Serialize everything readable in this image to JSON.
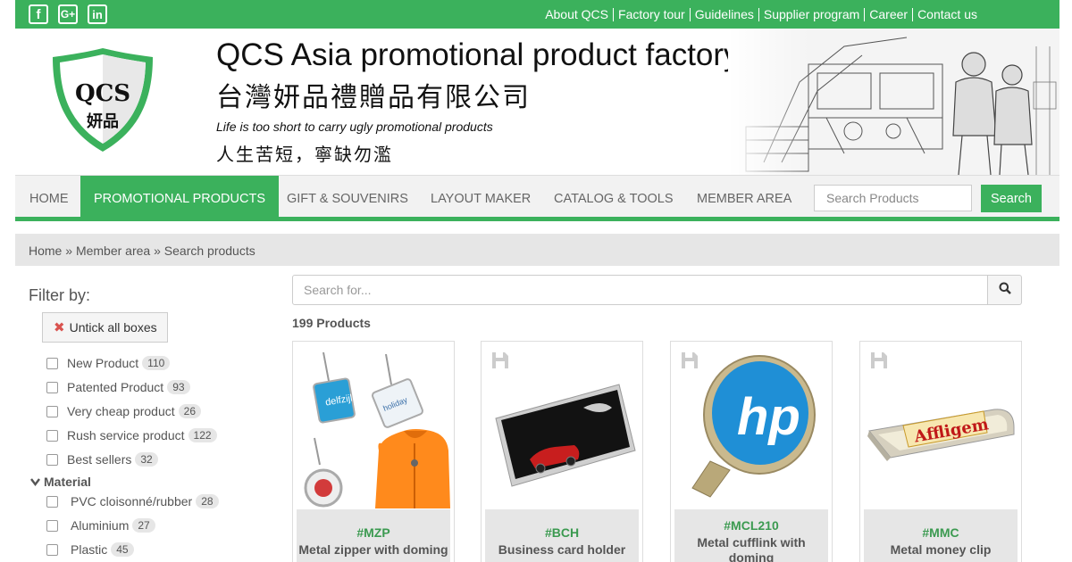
{
  "social": [
    {
      "icon": "facebook-icon",
      "glyph": "f"
    },
    {
      "icon": "google-plus-icon",
      "glyph": "G+"
    },
    {
      "icon": "linkedin-icon",
      "glyph": "in"
    }
  ],
  "toplinks": [
    "About QCS",
    "Factory tour",
    "Guidelines",
    "Supplier program",
    "Career",
    "Contact us"
  ],
  "header": {
    "logo_text": "QCS",
    "logo_cn": "妍品",
    "title": "QCS Asia promotional product factory",
    "title_cn": "台灣妍品禮贈品有限公司",
    "slogan": "Life is too short to carry ugly promotional products",
    "slogan_cn": "人生苦短，寧缺勿濫"
  },
  "nav": {
    "items": [
      "HOME",
      "PROMOTIONAL PRODUCTS",
      "GIFT & SOUVENIRS",
      "LAYOUT MAKER",
      "CATALOG & TOOLS",
      "MEMBER AREA"
    ],
    "active": "PROMOTIONAL PRODUCTS",
    "search_placeholder": "Search Products",
    "search_label": "Search"
  },
  "breadcrumb": [
    "Home",
    "Member area",
    "Search products"
  ],
  "sidebar": {
    "title": "Filter by:",
    "untick_label": "Untick all boxes",
    "filters": [
      {
        "label": "New Product",
        "count": "110"
      },
      {
        "label": "Patented Product",
        "count": "93"
      },
      {
        "label": "Very cheap product",
        "count": "26"
      },
      {
        "label": "Rush service product",
        "count": "122"
      },
      {
        "label": "Best sellers",
        "count": "32"
      }
    ],
    "category": "Material",
    "materials": [
      {
        "label": "PVC cloisonné/rubber",
        "count": "28"
      },
      {
        "label": "Aluminium",
        "count": "27"
      },
      {
        "label": "Plastic",
        "count": "45"
      }
    ]
  },
  "main": {
    "search_placeholder": "Search for...",
    "count_label": "199 Products",
    "products": [
      {
        "code": "#MZP",
        "name": "Metal zipper with doming"
      },
      {
        "code": "#BCH",
        "name": "Business card holder"
      },
      {
        "code": "#MCL210",
        "name": "Metal cufflink with doming"
      },
      {
        "code": "#MMC",
        "name": "Metal money clip"
      }
    ]
  },
  "colors": {
    "accent": "#3bb15c",
    "breadcrumb_bg": "#e6e6e6",
    "code_green": "#3b9a50"
  }
}
